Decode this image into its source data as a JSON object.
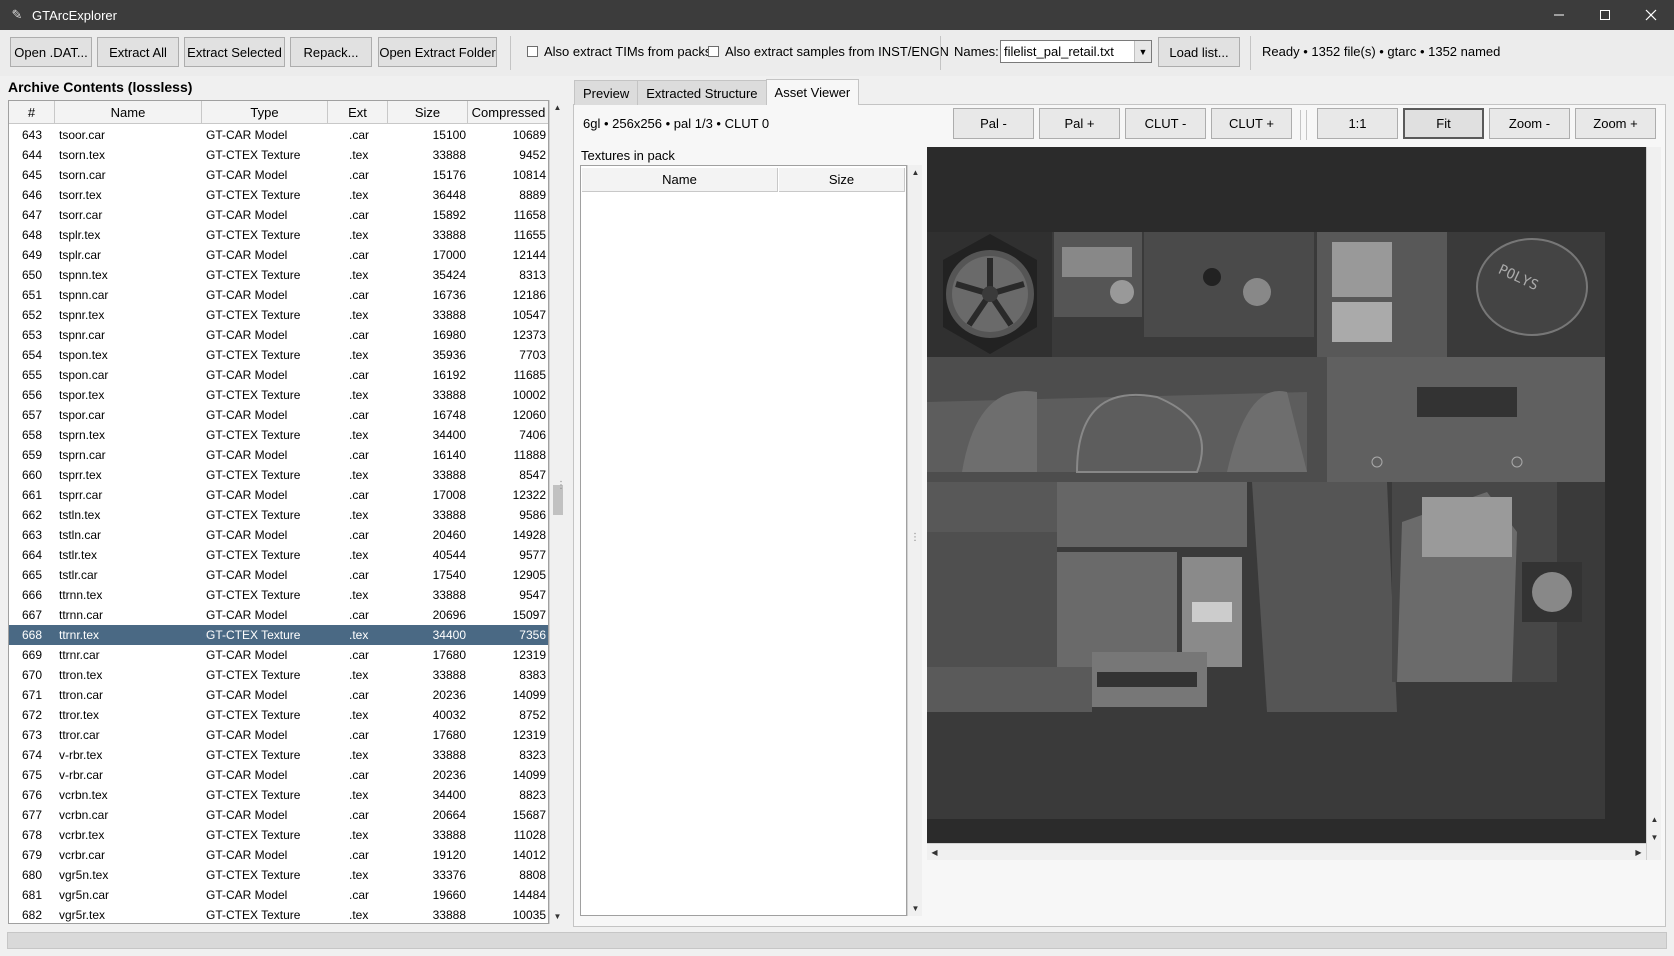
{
  "window": {
    "title": "GTArcExplorer",
    "app_icon": "feather-icon",
    "controls": [
      "minimize-icon",
      "maximize-icon",
      "close-icon"
    ]
  },
  "toolbar": {
    "open_dat": "Open .DAT...",
    "extract_all": "Extract All",
    "extract_selected": "Extract Selected",
    "repack": "Repack...",
    "open_extract_folder": "Open Extract Folder",
    "chk_tims": "Also extract TIMs from packs",
    "chk_samples": "Also extract samples from INST/ENGN",
    "names_label": "Names:",
    "names_value": "filelist_pal_retail.txt",
    "load_list": "Load list...",
    "status": "Ready  •  1352 file(s)  •  gtarc  •  1352 named"
  },
  "archive": {
    "title": "Archive Contents (lossless)",
    "columns": [
      "#",
      "Name",
      "Type",
      "Ext",
      "Size",
      "Compressed"
    ],
    "selected_index": 25,
    "rows": [
      [
        "643",
        "tsoor.car",
        "GT-CAR Model",
        ".car",
        "15100",
        "10689"
      ],
      [
        "644",
        "tsorn.tex",
        "GT-CTEX Texture",
        ".tex",
        "33888",
        "9452"
      ],
      [
        "645",
        "tsorn.car",
        "GT-CAR Model",
        ".car",
        "15176",
        "10814"
      ],
      [
        "646",
        "tsorr.tex",
        "GT-CTEX Texture",
        ".tex",
        "36448",
        "8889"
      ],
      [
        "647",
        "tsorr.car",
        "GT-CAR Model",
        ".car",
        "15892",
        "11658"
      ],
      [
        "648",
        "tsplr.tex",
        "GT-CTEX Texture",
        ".tex",
        "33888",
        "11655"
      ],
      [
        "649",
        "tsplr.car",
        "GT-CAR Model",
        ".car",
        "17000",
        "12144"
      ],
      [
        "650",
        "tspnn.tex",
        "GT-CTEX Texture",
        ".tex",
        "35424",
        "8313"
      ],
      [
        "651",
        "tspnn.car",
        "GT-CAR Model",
        ".car",
        "16736",
        "12186"
      ],
      [
        "652",
        "tspnr.tex",
        "GT-CTEX Texture",
        ".tex",
        "33888",
        "10547"
      ],
      [
        "653",
        "tspnr.car",
        "GT-CAR Model",
        ".car",
        "16980",
        "12373"
      ],
      [
        "654",
        "tspon.tex",
        "GT-CTEX Texture",
        ".tex",
        "35936",
        "7703"
      ],
      [
        "655",
        "tspon.car",
        "GT-CAR Model",
        ".car",
        "16192",
        "11685"
      ],
      [
        "656",
        "tspor.tex",
        "GT-CTEX Texture",
        ".tex",
        "33888",
        "10002"
      ],
      [
        "657",
        "tspor.car",
        "GT-CAR Model",
        ".car",
        "16748",
        "12060"
      ],
      [
        "658",
        "tsprn.tex",
        "GT-CTEX Texture",
        ".tex",
        "34400",
        "7406"
      ],
      [
        "659",
        "tsprn.car",
        "GT-CAR Model",
        ".car",
        "16140",
        "11888"
      ],
      [
        "660",
        "tsprr.tex",
        "GT-CTEX Texture",
        ".tex",
        "33888",
        "8547"
      ],
      [
        "661",
        "tsprr.car",
        "GT-CAR Model",
        ".car",
        "17008",
        "12322"
      ],
      [
        "662",
        "tstln.tex",
        "GT-CTEX Texture",
        ".tex",
        "33888",
        "9586"
      ],
      [
        "663",
        "tstln.car",
        "GT-CAR Model",
        ".car",
        "20460",
        "14928"
      ],
      [
        "664",
        "tstlr.tex",
        "GT-CTEX Texture",
        ".tex",
        "40544",
        "9577"
      ],
      [
        "665",
        "tstlr.car",
        "GT-CAR Model",
        ".car",
        "17540",
        "12905"
      ],
      [
        "666",
        "ttrnn.tex",
        "GT-CTEX Texture",
        ".tex",
        "33888",
        "9547"
      ],
      [
        "667",
        "ttrnn.car",
        "GT-CAR Model",
        ".car",
        "20696",
        "15097"
      ],
      [
        "668",
        "ttrnr.tex",
        "GT-CTEX Texture",
        ".tex",
        "34400",
        "7356"
      ],
      [
        "669",
        "ttrnr.car",
        "GT-CAR Model",
        ".car",
        "17680",
        "12319"
      ],
      [
        "670",
        "ttron.tex",
        "GT-CTEX Texture",
        ".tex",
        "33888",
        "8383"
      ],
      [
        "671",
        "ttron.car",
        "GT-CAR Model",
        ".car",
        "20236",
        "14099"
      ],
      [
        "672",
        "ttror.tex",
        "GT-CTEX Texture",
        ".tex",
        "40032",
        "8752"
      ],
      [
        "673",
        "ttror.car",
        "GT-CAR Model",
        ".car",
        "17680",
        "12319"
      ],
      [
        "674",
        "v-rbr.tex",
        "GT-CTEX Texture",
        ".tex",
        "33888",
        "8323"
      ],
      [
        "675",
        "v-rbr.car",
        "GT-CAR Model",
        ".car",
        "20236",
        "14099"
      ],
      [
        "676",
        "vcrbn.tex",
        "GT-CTEX Texture",
        ".tex",
        "34400",
        "8823"
      ],
      [
        "677",
        "vcrbn.car",
        "GT-CAR Model",
        ".car",
        "20664",
        "15687"
      ],
      [
        "678",
        "vcrbr.tex",
        "GT-CTEX Texture",
        ".tex",
        "33888",
        "11028"
      ],
      [
        "679",
        "vcrbr.car",
        "GT-CAR Model",
        ".car",
        "19120",
        "14012"
      ],
      [
        "680",
        "vgr5n.tex",
        "GT-CTEX Texture",
        ".tex",
        "33376",
        "8808"
      ],
      [
        "681",
        "vgr5n.car",
        "GT-CAR Model",
        ".car",
        "19660",
        "14484"
      ],
      [
        "682",
        "vgr5r.tex",
        "GT-CTEX Texture",
        ".tex",
        "33888",
        "10035"
      ]
    ]
  },
  "tabs": [
    "Preview",
    "Extracted Structure",
    "Asset Viewer"
  ],
  "active_tab": "Asset Viewer",
  "asset_viewer": {
    "info": "6gl  •  256x256  •  pal 1/3  •  CLUT 0",
    "buttons": {
      "pal_minus": "Pal -",
      "pal_plus": "Pal +",
      "clut_minus": "CLUT -",
      "clut_plus": "CLUT +",
      "one_to_one": "1:1",
      "fit": "Fit",
      "zoom_minus": "Zoom -",
      "zoom_plus": "Zoom +"
    },
    "textures_label": "Textures in pack",
    "textures_columns": [
      "Name",
      "Size"
    ],
    "preview_texture": "POLYS"
  },
  "colors": {
    "titlebar": "#3c3c3c",
    "selection": "#4a6984",
    "canvas_bg": "#2b2b2b"
  }
}
